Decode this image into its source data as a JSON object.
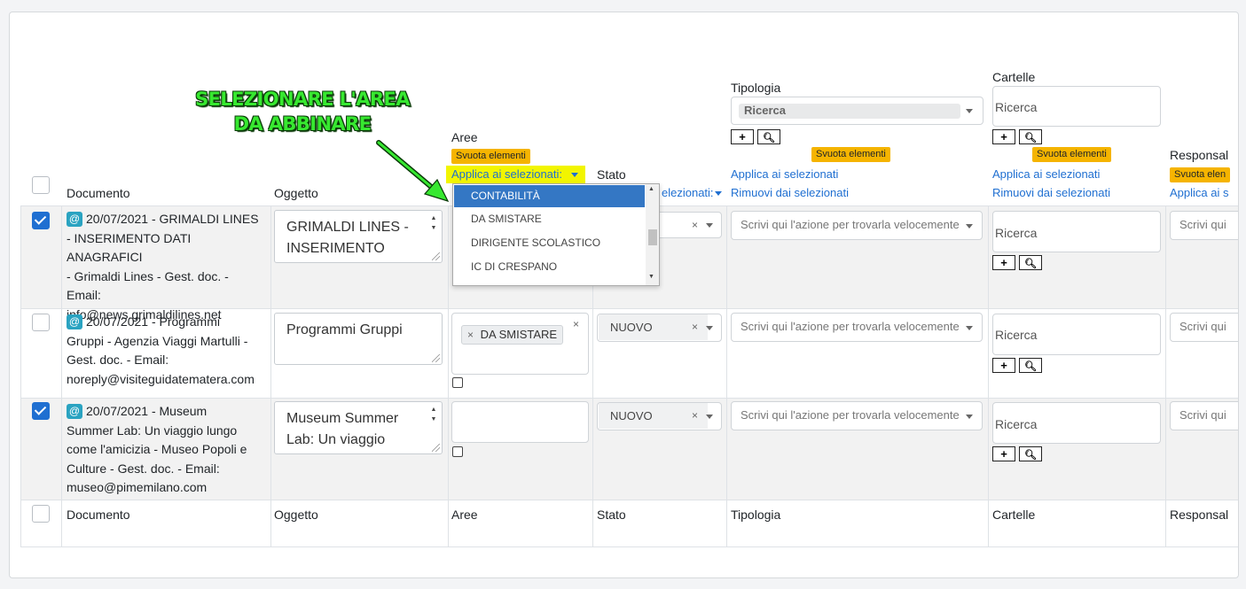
{
  "annotation": {
    "line1": "SELEZIONARE L'AREA",
    "line2": "DA ABBINARE"
  },
  "columns": {
    "documento": "Documento",
    "oggetto": "Oggetto",
    "aree": "Aree",
    "stato": "Stato",
    "tipologia": "Tipologia",
    "cartelle": "Cartelle",
    "responsabile": "Responsal"
  },
  "header_controls": {
    "svuota": "Svuota elementi",
    "aree_applica_dropdown": "Applica ai selezionati:",
    "stato_applica_dropdown": "elezionati:",
    "applica": "Applica ai selezionati",
    "rimuovi": "Rimuovi dai selezionati",
    "resp_applica": "Applica ai s",
    "resp_svuota": "Svuota elen",
    "tipologia_search": "Ricerca",
    "cartelle_search": "Ricerca"
  },
  "icons": {
    "plus": "+",
    "search": "search-icon"
  },
  "dropdown": {
    "options": [
      "CONTABILITÀ",
      "DA SMISTARE",
      "DIRIGENTE SCOLASTICO",
      "IC DI CRESPANO"
    ],
    "active_index": 0
  },
  "rows": [
    {
      "checked": true,
      "doc_date": "20/07/2021 - GRIMALDI LINES",
      "doc_lines": [
        "- INSERIMENTO DATI ANAGRAFICI",
        "- Grimaldi Lines - Gest. doc. -",
        "Email:",
        "info@news.grimaldilines.net"
      ],
      "oggetto": [
        "GRIMALDI LINES -",
        "INSERIMENTO"
      ],
      "area_tag": "",
      "stato": "",
      "tipologia_placeholder": "Scrivi qui l'azione per trovarla velocemente",
      "cartelle_search": "Ricerca",
      "resp_placeholder": "Scrivi qui"
    },
    {
      "checked": false,
      "doc_date": "20/07/2021 - Programmi",
      "doc_lines": [
        "Gruppi - Agenzia Viaggi Martulli -",
        "Gest. doc. - Email:",
        "noreply@visiteguidatematera.com"
      ],
      "oggetto": [
        "Programmi Gruppi"
      ],
      "area_tag": "DA SMISTARE",
      "stato": "NUOVO",
      "tipologia_placeholder": "Scrivi qui l'azione per trovarla velocemente",
      "cartelle_search": "Ricerca",
      "resp_placeholder": "Scrivi qui"
    },
    {
      "checked": true,
      "doc_date": "20/07/2021 - Museum",
      "doc_lines": [
        "Summer Lab: Un viaggio lungo",
        "come l'amicizia - Museo Popoli e",
        "Culture - Gest. doc. - Email:",
        "museo@pimemilano.com"
      ],
      "oggetto": [
        "Museum Summer",
        "Lab: Un viaggio"
      ],
      "area_tag": "",
      "stato": "NUOVO",
      "tipologia_placeholder": "Scrivi qui l'azione per trovarla velocemente",
      "cartelle_search": "Ricerca",
      "resp_placeholder": "Scrivi qui"
    }
  ]
}
